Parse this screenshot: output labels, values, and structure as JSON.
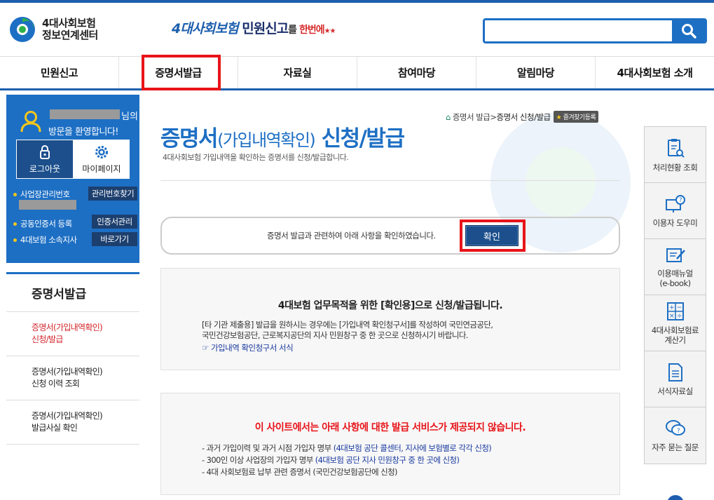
{
  "header": {
    "logo_line1": "4대사회보험",
    "logo_line2": "정보연계센터",
    "slogan": {
      "part1": "4대사회보험",
      "part2": " 민원신고",
      "part3": "를 ",
      "part4": "한번에"
    },
    "search_placeholder": ""
  },
  "gnb": [
    {
      "label": "민원신고"
    },
    {
      "label": "증명서발급"
    },
    {
      "label": "자료실"
    },
    {
      "label": "참여마당"
    },
    {
      "label": "알림마당"
    },
    {
      "label": "4대사회보험 소개"
    }
  ],
  "login": {
    "suffix": "님의",
    "welcome": "방문을 환영합니다!",
    "logout": "로그아웃",
    "mypage": "마이페이지",
    "biz_no_label": "사업장관리번호",
    "biz_no_btn": "관리번호찾기",
    "cert_label": "공동인증서 등록",
    "cert_btn": "인증서관리",
    "branch_label": "4대보험 소속지사",
    "branch_btn": "바로가기"
  },
  "lnb": {
    "title": "증명서발급",
    "items": [
      {
        "line1": "증명서(가입내역확인)",
        "line2": "신청/발급"
      },
      {
        "line1": "증명서(가입내역확인)",
        "line2": "신청 이력 조회"
      },
      {
        "line1": "증명서(가입내역확인)",
        "line2": "발급사실 확인"
      }
    ]
  },
  "content": {
    "title_a": "증명서",
    "title_b": "(가입내역확인)",
    "title_c": " 신청/발급",
    "desc": "4대사회보험 가입내역을 확인하는 증명서를 신청/발급합니다.",
    "breadcrumb": {
      "home": "증명서 발급",
      "sep": " > ",
      "current": "증명서 신청/발급",
      "fav": "즐겨찾기등록"
    },
    "confirm_text": "증명서 발급과 관련하여 아래 사항을 확인하였습니다.",
    "confirm_btn": "확인",
    "box1": {
      "title": "4대보험 업무목적을 위한 [확인용]으로 신청/발급됩니다.",
      "line1": "[타 기관 제출용] 발급을 원하시는 경우에는 [가입내역 확인청구서]를 작성하여 국민연금공단,",
      "line2": "국민건강보험공단, 근로복지공단의 지사 민원창구 중 한 곳으로 신청하시기 바랍니다.",
      "link": "☞ 가입내역 확인청구서 서식"
    },
    "box2": {
      "title": "이 사이트에서는 아래 사항에 대한 발급 서비스가 제공되지 않습니다.",
      "i1_a": "- 과거 가입이력 및 과거 시점 가입자 명부 ",
      "i1_b": "(4대보험 공단 콜센터, 지사에 보험별로 각각 신청)",
      "i2_a": "- 300인 이상 사업장의 가입자 명부 ",
      "i2_b": "(4대보험 공단 지사 민원창구 중 한 곳에 신청)",
      "i3": "- 4대 사회보험료 납부 관련 증명서 (국민건강보험공단에 신청)"
    }
  },
  "quick": [
    {
      "label1": "처리현황 조회",
      "label2": ""
    },
    {
      "label1": "이용자 도우미",
      "label2": ""
    },
    {
      "label1": "이용매뉴얼",
      "label2": "(e-book)"
    },
    {
      "label1": "4대사회보험료",
      "label2": "계산기"
    },
    {
      "label1": "서식자료실",
      "label2": ""
    },
    {
      "label1": "자주 묻는 질문",
      "label2": ""
    }
  ],
  "colors": {
    "brand_blue": "#1d6fc4",
    "highlight_red": "#e8141a",
    "navy": "#1c4f8c"
  }
}
